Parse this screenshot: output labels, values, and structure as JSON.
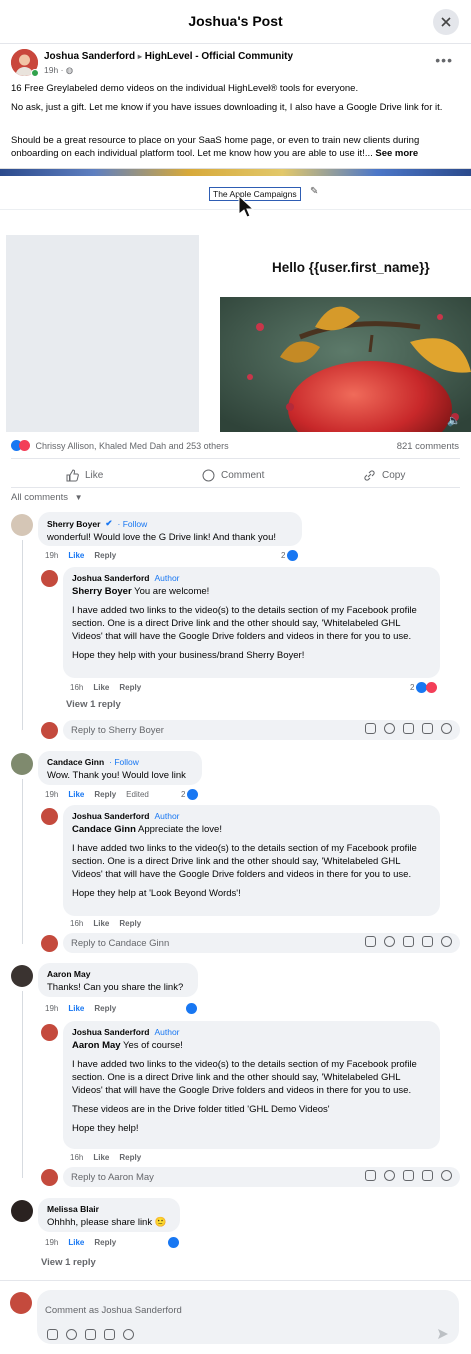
{
  "header": {
    "title": "Joshua's Post"
  },
  "post": {
    "author": "Joshua Sanderford",
    "group": "HighLevel - Official Community",
    "time": "19h",
    "p1": "16 Free Greylabeled demo videos on the individual HighLevel® tools for everyone.",
    "p2": "No ask, just a gift. Let me know if you have issues downloading it, I also have a Google Drive link for it.",
    "p3": "Should be a great resource to place on your SaaS home page, or even to train new clients during onboarding on each individual platform tool. Let me know how you are able to use it!...",
    "see_more": "See more",
    "media": {
      "campaign_label": "The Apple Campaigns",
      "hello": "Hello {{user.first_name}}"
    },
    "reactions_text": "Chrissy Allison, Khaled Med Dah and 253 others",
    "comments_count": "821 comments",
    "actions": {
      "like": "Like",
      "comment": "Comment",
      "copy": "Copy"
    },
    "filter": "All comments"
  },
  "comments": [
    {
      "name": "Sherry Boyer",
      "follow": "Follow",
      "text": "wonderful! Would love the G Drive link! And thank you!",
      "time": "19h",
      "like": "Like",
      "reply": "Reply",
      "count": "2",
      "reply_item": {
        "name": "Joshua Sanderford",
        "badge": "Author",
        "mention": "Sherry Boyer",
        "first": "You are welcome!",
        "body": "I have added two links to the video(s) to the details section of my Facebook profile section. One is a direct Drive link and the other should say, 'Whitelabeled GHL Videos' that will have the Google Drive folders and videos in there for you to use.",
        "last": "Hope they help with your business/brand Sherry Boyer!",
        "time": "16h",
        "like": "Like",
        "reply": "Reply",
        "count": "2"
      },
      "view_replies": "View 1 reply",
      "reply_placeholder": "Reply to Sherry Boyer"
    },
    {
      "name": "Candace Ginn",
      "follow": "Follow",
      "text": "Wow. Thank you! Would love link",
      "time": "19h",
      "like": "Like",
      "reply": "Reply",
      "edited": "Edited",
      "count": "2",
      "reply_item": {
        "name": "Joshua Sanderford",
        "badge": "Author",
        "mention": "Candace Ginn",
        "first": "Appreciate the love!",
        "body": "I have added two links to the video(s) to the details section of my Facebook profile section. One is a direct Drive link and the other should say, 'Whitelabeled GHL Videos' that will have the Google Drive folders and videos in there for you to use.",
        "last": "Hope they help at 'Look Beyond Words'!",
        "time": "16h",
        "like": "Like",
        "reply": "Reply"
      },
      "reply_placeholder": "Reply to Candace Ginn"
    },
    {
      "name": "Aaron May",
      "text": "Thanks! Can you share the link?",
      "time": "19h",
      "like": "Like",
      "reply": "Reply",
      "reply_item": {
        "name": "Joshua Sanderford",
        "badge": "Author",
        "mention": "Aaron May",
        "first": "Yes of course!",
        "body": "I have added two links to the video(s) to the details section of my Facebook profile section. One is a direct Drive link and the other should say, 'Whitelabeled GHL Videos' that will have the Google Drive folders and videos in there for you to use.",
        "extra": "These videos are in the Drive folder titled 'GHL Demo Videos'",
        "last": "Hope they help!",
        "time": "16h",
        "like": "Like",
        "reply": "Reply"
      },
      "reply_placeholder": "Reply to Aaron May"
    },
    {
      "name": "Melissa Blair",
      "text": "Ohhhh, please share link 🙂",
      "time": "19h",
      "like": "Like",
      "reply": "Reply",
      "view_replies": "View 1 reply"
    }
  ],
  "footer": {
    "placeholder": "Comment as Joshua Sanderford"
  },
  "colors": {
    "accent": "#1877f2",
    "love": "#f33e58",
    "bubble": "#f0f2f5"
  }
}
